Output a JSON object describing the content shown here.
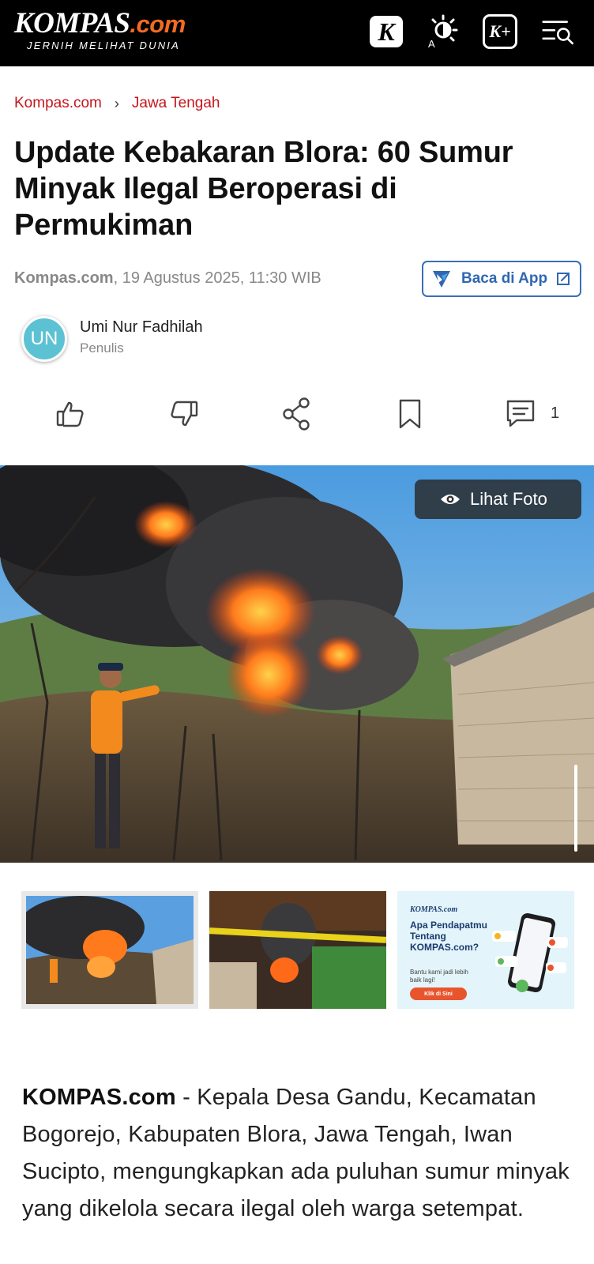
{
  "header": {
    "logo_main": "KOMPAS",
    "logo_suffix": ".com",
    "tagline": "JERNIH MELIHAT DUNIA",
    "k_letter": "K",
    "kplus_label": "K+"
  },
  "breadcrumb": {
    "home": "Kompas.com",
    "separator": "›",
    "section": "Jawa Tengah"
  },
  "article": {
    "title": "Update Kebakaran Blora: 60 Sumur Minyak Ilegal Beroperasi di Permukiman",
    "source": "Kompas.com",
    "datetime": ", 19 Agustus 2025, 11:30 WIB",
    "app_button": "Baca di App",
    "lead_source": "KOMPAS.com",
    "lead_text": " - Kepala Desa Gandu, Kecamatan Bogorejo, Kabupaten Blora, Jawa Tengah, Iwan Sucipto, mengungkapkan ada puluhan sumur minyak yang dikelola secara ilegal oleh warga setempat."
  },
  "author": {
    "initials": "UN",
    "name": "Umi Nur Fadhilah",
    "role": "Penulis",
    "avatar_color": "#5cc2d3"
  },
  "actions": {
    "icons": [
      "thumbs-up-icon",
      "thumbs-down-icon",
      "share-icon",
      "bookmark-icon",
      "comment-icon"
    ],
    "comment_count": "1"
  },
  "gallery": {
    "view_label": "Lihat Foto",
    "ad": {
      "brand": "KOMPAS.com",
      "question": "Apa Pendapatmu Tentang KOMPAS.com?",
      "subtext": "Bantu kami jadi lebih baik lagi!",
      "cta": "Klik di Sini"
    }
  },
  "colors": {
    "brand_red": "#c4161c",
    "brand_orange": "#f26b21",
    "link_blue": "#2f67b2"
  }
}
